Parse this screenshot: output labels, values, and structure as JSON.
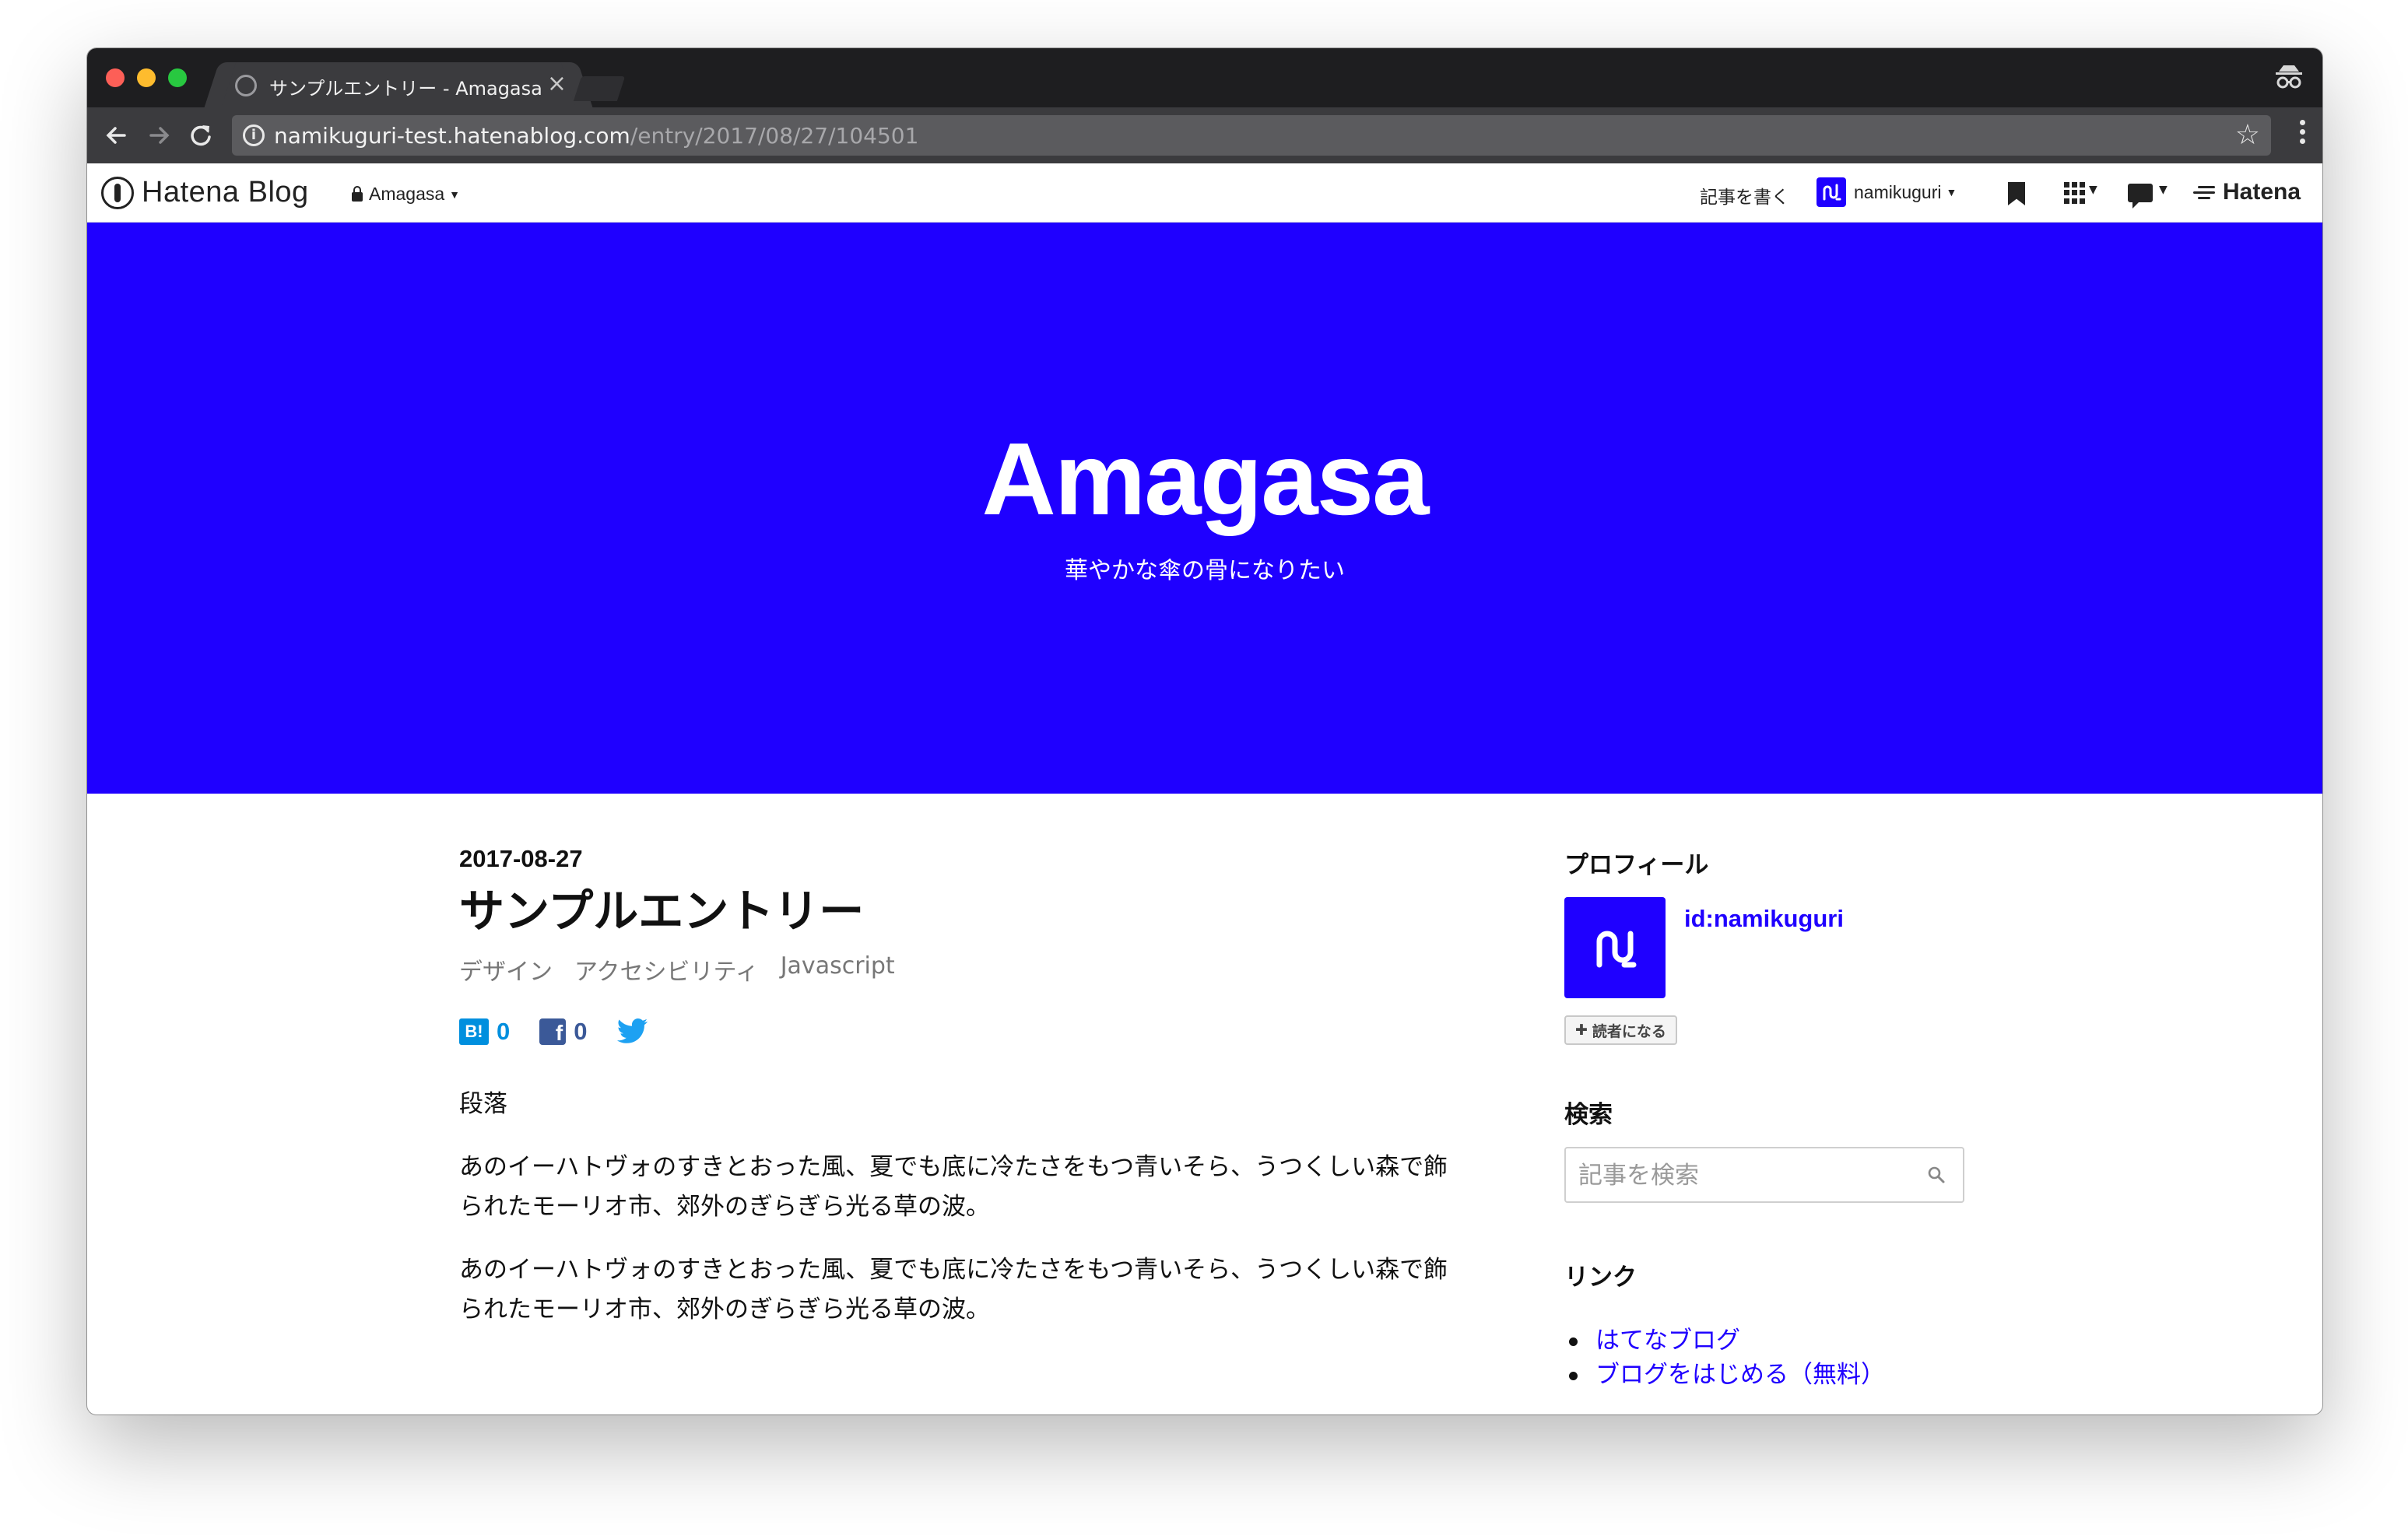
{
  "browser": {
    "tab_title": "サンプルエントリー - Amagasa",
    "tab_close": "×",
    "url_host": "namikuguri-test.hatenablog.com",
    "url_path": "/entry/2017/08/27/104501"
  },
  "navbar": {
    "logo_text": "Hatena Blog",
    "blog_selector": "Amagasa",
    "write_label": "記事を書く",
    "username": "namikuguri",
    "hatena_label": "Hatena"
  },
  "banner": {
    "title": "Amagasa",
    "description": "華やかな傘の骨になりたい",
    "background": "#1f00ff"
  },
  "entry": {
    "date": "2017-08-27",
    "title": "サンプルエントリー",
    "categories": [
      "デザイン",
      "アクセシビリティ",
      "Javascript"
    ],
    "share": {
      "hatena_badge": "B!",
      "hatena_count": "0",
      "facebook_badge": "f",
      "facebook_count": "0"
    },
    "paragraphs": [
      "段落",
      "あのイーハトヴォのすきとおった風、夏でも底に冷たさをもつ青いそら、うつくしい森で飾られたモーリオ市、郊外のぎらぎら光る草の波。",
      "あのイーハトヴォのすきとおった風、夏でも底に冷たさをもつ青いそら、うつくしい森で飾られたモーリオ市、郊外のぎらぎら光る草の波。"
    ]
  },
  "sidebar": {
    "profile_heading": "プロフィール",
    "profile_id": "id:namikuguri",
    "subscribe_label": "読者になる",
    "search_heading": "検索",
    "search_placeholder": "記事を検索",
    "links_heading": "リンク",
    "links": [
      "はてなブログ",
      "ブログをはじめる（無料）"
    ]
  }
}
